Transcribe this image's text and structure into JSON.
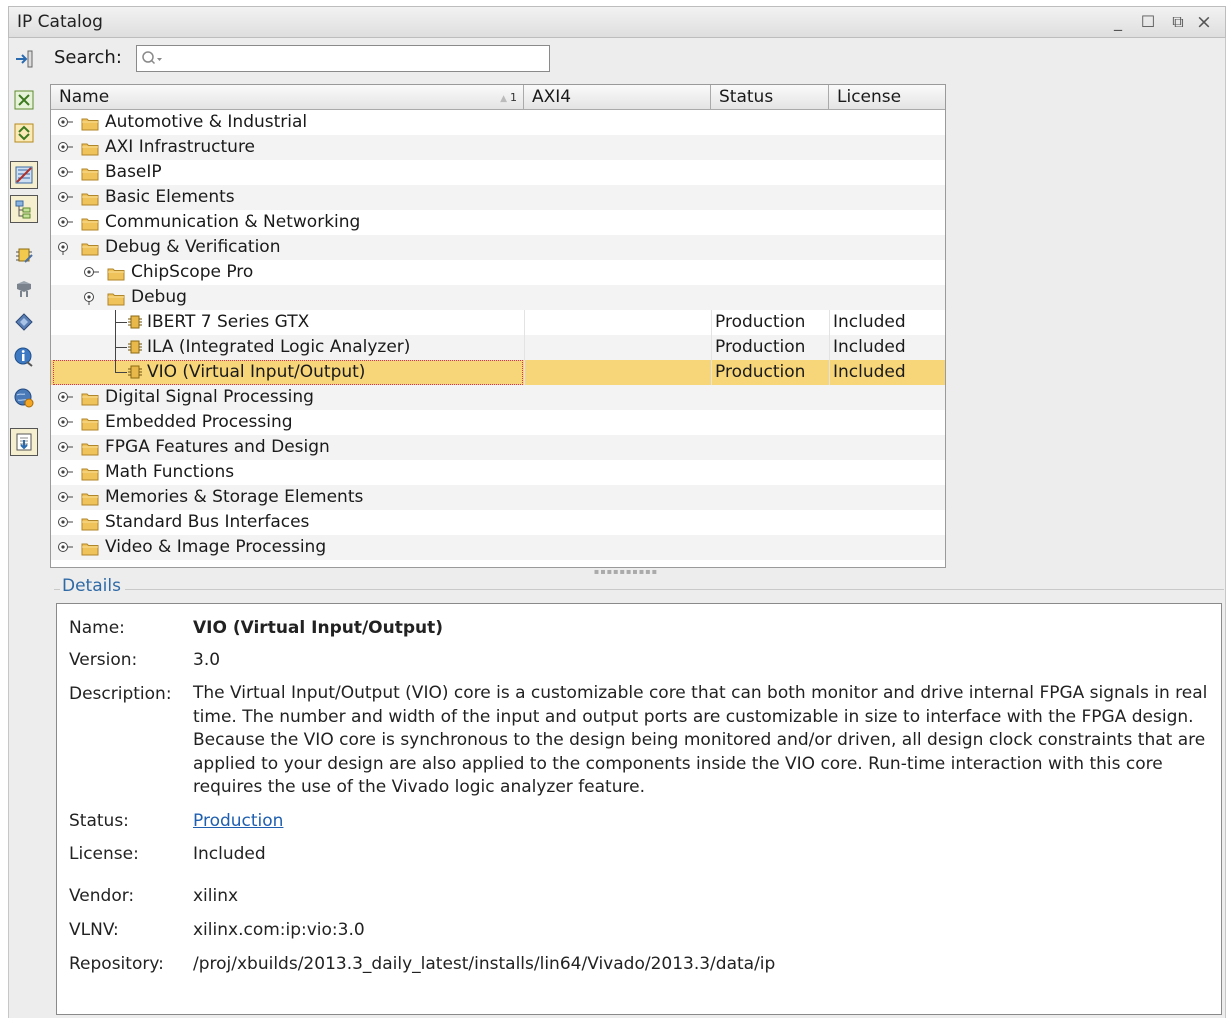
{
  "window": {
    "title": "IP Catalog",
    "controls": {
      "minimize": "_",
      "maximize": "☐",
      "restore": "⧉",
      "close": "×"
    }
  },
  "toolbar": {
    "icons": [
      "collapse-panel-icon",
      "collapse-all-icon",
      "expand-all-icon",
      "filter-icon",
      "group-view-icon",
      "customize-ip-icon",
      "repository-icon",
      "ip-settings-icon",
      "ip-info-icon",
      "web-update-icon",
      "export-icon"
    ]
  },
  "search": {
    "label": "Search:",
    "value": "",
    "placeholder": ""
  },
  "table": {
    "columns": [
      {
        "label": "Name",
        "sort_index": "1"
      },
      {
        "label": "AXI4"
      },
      {
        "label": "Status"
      },
      {
        "label": "License"
      }
    ],
    "rows": [
      {
        "name": "Automotive & Industrial",
        "depth": 0,
        "kind": "folder",
        "expanded": false,
        "status": "",
        "license": ""
      },
      {
        "name": "AXI Infrastructure",
        "depth": 0,
        "kind": "folder",
        "expanded": false,
        "status": "",
        "license": ""
      },
      {
        "name": "BaseIP",
        "depth": 0,
        "kind": "folder",
        "expanded": false,
        "status": "",
        "license": ""
      },
      {
        "name": "Basic Elements",
        "depth": 0,
        "kind": "folder",
        "expanded": false,
        "status": "",
        "license": ""
      },
      {
        "name": "Communication & Networking",
        "depth": 0,
        "kind": "folder",
        "expanded": false,
        "status": "",
        "license": ""
      },
      {
        "name": "Debug & Verification",
        "depth": 0,
        "kind": "folder",
        "expanded": true,
        "status": "",
        "license": ""
      },
      {
        "name": "ChipScope Pro",
        "depth": 1,
        "kind": "folder",
        "expanded": false,
        "status": "",
        "license": ""
      },
      {
        "name": "Debug",
        "depth": 1,
        "kind": "folder",
        "expanded": true,
        "status": "",
        "license": ""
      },
      {
        "name": "IBERT 7 Series GTX",
        "depth": 2,
        "kind": "ip",
        "status": "Production",
        "license": "Included"
      },
      {
        "name": "ILA (Integrated Logic Analyzer)",
        "depth": 2,
        "kind": "ip",
        "status": "Production",
        "license": "Included"
      },
      {
        "name": "VIO (Virtual Input/Output)",
        "depth": 2,
        "kind": "ip",
        "status": "Production",
        "license": "Included",
        "selected": true
      },
      {
        "name": "Digital Signal Processing",
        "depth": 0,
        "kind": "folder",
        "expanded": false,
        "status": "",
        "license": ""
      },
      {
        "name": "Embedded Processing",
        "depth": 0,
        "kind": "folder",
        "expanded": false,
        "status": "",
        "license": ""
      },
      {
        "name": "FPGA Features and Design",
        "depth": 0,
        "kind": "folder",
        "expanded": false,
        "status": "",
        "license": ""
      },
      {
        "name": "Math Functions",
        "depth": 0,
        "kind": "folder",
        "expanded": false,
        "status": "",
        "license": ""
      },
      {
        "name": "Memories & Storage Elements",
        "depth": 0,
        "kind": "folder",
        "expanded": false,
        "status": "",
        "license": ""
      },
      {
        "name": "Standard Bus Interfaces",
        "depth": 0,
        "kind": "folder",
        "expanded": false,
        "status": "",
        "license": ""
      },
      {
        "name": "Video & Image Processing",
        "depth": 0,
        "kind": "folder",
        "expanded": false,
        "status": "",
        "license": ""
      }
    ]
  },
  "details": {
    "section_title": "Details",
    "name_label": "Name:",
    "name": "VIO (Virtual Input/Output)",
    "version_label": "Version:",
    "version": "3.0",
    "description_label": "Description:",
    "description": "The Virtual Input/Output (VIO) core is a customizable core that can both monitor and drive internal FPGA signals in real time. The number and width of the input and output ports are customizable in size to interface with the FPGA design. Because the VIO core is synchronous to the design being monitored and/or driven, all design clock constraints that are applied to your design are also applied to the components inside the VIO core. Run-time interaction with this core requires the use of the Vivado logic analyzer feature.",
    "status_label": "Status:",
    "status": "Production",
    "license_label": "License:",
    "license": "Included",
    "vendor_label": "Vendor:",
    "vendor": "xilinx",
    "vlnv_label": "VLNV:",
    "vlnv": "xilinx.com:ip:vio:3.0",
    "repository_label": "Repository:",
    "repository": "/proj/xbuilds/2013.3_daily_latest/installs/lin64/Vivado/2013.3/data/ip"
  },
  "colors": {
    "selection": "#f7d679",
    "link": "#1f5fb0",
    "section_title": "#2f6aa6",
    "folder": "#f0c35a"
  }
}
